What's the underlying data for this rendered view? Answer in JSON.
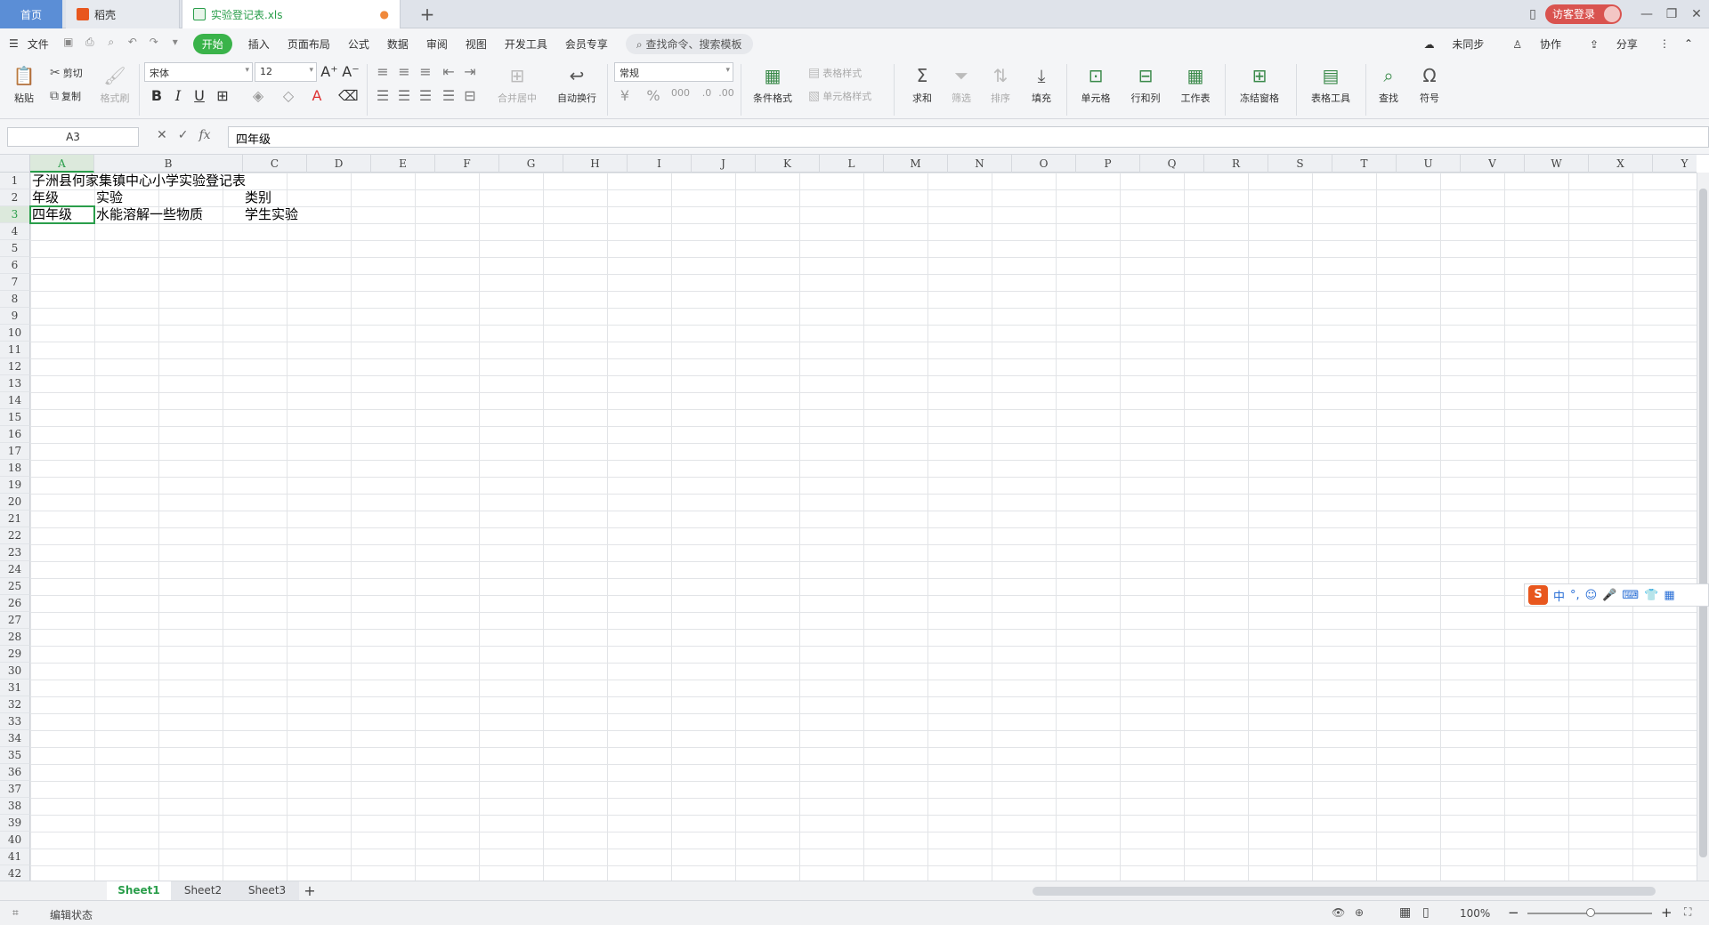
{
  "tabs": {
    "home": "首页",
    "daoke": "稻壳",
    "doc": "实验登记表.xls"
  },
  "window": {
    "login": "访客登录"
  },
  "menu": {
    "file": "文件",
    "items": [
      "开始",
      "插入",
      "页面布局",
      "公式",
      "数据",
      "审阅",
      "视图",
      "开发工具",
      "会员专享"
    ],
    "search": "查找命令、搜索模板",
    "unsync": "未同步",
    "collab": "协作",
    "share": "分享"
  },
  "ribbon": {
    "paste": "粘贴",
    "cut": "剪切",
    "copy": "复制",
    "format_painter": "格式刷",
    "font_name": "宋体",
    "font_size": "12",
    "merge": "合并居中",
    "wrap": "自动换行",
    "number_format": "常规",
    "cond_format": "条件格式",
    "table_style": "表格样式",
    "cell_style": "单元格样式",
    "sum": "求和",
    "filter": "筛选",
    "sort": "排序",
    "fill": "填充",
    "cell": "单元格",
    "rowcol": "行和列",
    "worksheet": "工作表",
    "freeze": "冻结窗格",
    "table_tools": "表格工具",
    "find": "查找",
    "symbol": "符号"
  },
  "formula_bar": {
    "name_box": "A3",
    "content": "四年级"
  },
  "columns": [
    "A",
    "B",
    "C",
    "D",
    "E",
    "F",
    "G",
    "H",
    "I",
    "J",
    "K",
    "L",
    "M",
    "N",
    "O",
    "P",
    "Q",
    "R",
    "S",
    "T",
    "U",
    "V",
    "W",
    "X",
    "Y"
  ],
  "rows": [
    "1",
    "2",
    "3",
    "4",
    "5",
    "6",
    "7",
    "8",
    "9",
    "10",
    "11",
    "12",
    "13",
    "14",
    "15",
    "16",
    "17",
    "18",
    "19",
    "20",
    "21",
    "22",
    "23",
    "24",
    "25",
    "26",
    "27",
    "28",
    "29",
    "30",
    "31",
    "32",
    "33",
    "34",
    "35",
    "36",
    "37",
    "38",
    "39",
    "40",
    "41",
    "42"
  ],
  "cells": {
    "A1": "子洲县何家集镇中心小学实验登记表",
    "A2": "年级",
    "B2": "实验",
    "C2": "类别",
    "A3": "四年级",
    "B3": "水能溶解一些物质",
    "C3": "学生实验"
  },
  "sheet_tabs": [
    "Sheet1",
    "Sheet2",
    "Sheet3"
  ],
  "status": {
    "mode": "编辑状态",
    "zoom": "100%"
  },
  "ime": {
    "label": "中"
  }
}
